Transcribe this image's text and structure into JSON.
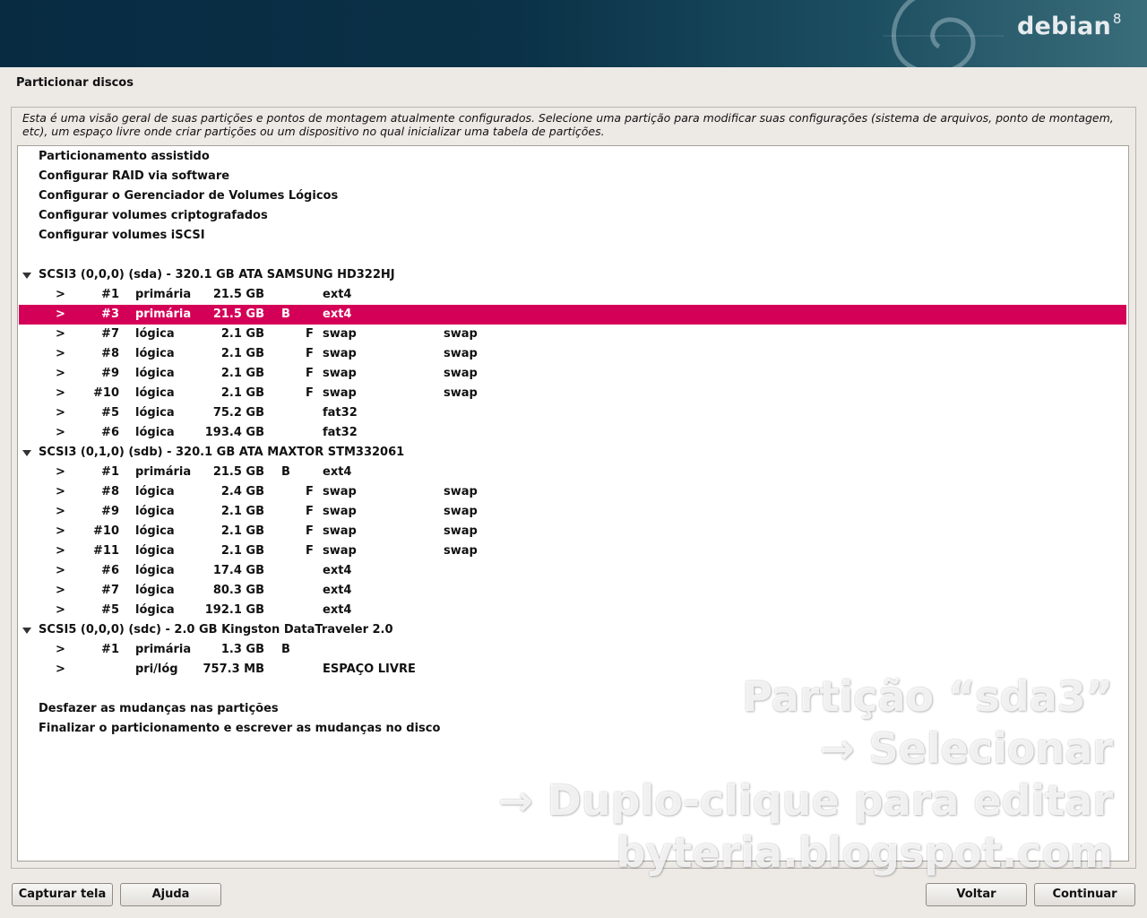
{
  "banner": {
    "logo_text": "debian",
    "logo_version": "8"
  },
  "page_title": "Particionar discos",
  "description": "Esta é uma visão geral de suas partições e pontos de montagem atualmente configurados. Selecione uma partição para modificar suas configurações (sistema de arquivos, ponto de montagem, etc), um espaço livre onde criar partições ou um dispositivo no qual inicializar uma tabela de partições.",
  "menu_top": [
    "Particionamento assistido",
    "Configurar RAID via software",
    "Configurar o Gerenciador de Volumes Lógicos",
    "Configurar volumes criptografados",
    "Configurar volumes iSCSI"
  ],
  "disks": [
    {
      "label": "SCSI3 (0,0,0) (sda) - 320.1 GB ATA SAMSUNG HD322HJ",
      "partitions": [
        {
          "arrow": ">",
          "num": "#1",
          "type": "primária",
          "size": "21.5 GB",
          "flag": "",
          "fs": "ext4",
          "mount": ""
        },
        {
          "arrow": ">",
          "num": "#3",
          "type": "primária",
          "size": "21.5 GB",
          "flag": "B",
          "fs": "ext4",
          "mount": "",
          "selected": true
        },
        {
          "arrow": ">",
          "num": "#7",
          "type": "lógica",
          "size": "2.1 GB",
          "flag": "F",
          "fs": "swap",
          "mount": "swap"
        },
        {
          "arrow": ">",
          "num": "#8",
          "type": "lógica",
          "size": "2.1 GB",
          "flag": "F",
          "fs": "swap",
          "mount": "swap"
        },
        {
          "arrow": ">",
          "num": "#9",
          "type": "lógica",
          "size": "2.1 GB",
          "flag": "F",
          "fs": "swap",
          "mount": "swap"
        },
        {
          "arrow": ">",
          "num": "#10",
          "type": "lógica",
          "size": "2.1 GB",
          "flag": "F",
          "fs": "swap",
          "mount": "swap"
        },
        {
          "arrow": ">",
          "num": "#5",
          "type": "lógica",
          "size": "75.2 GB",
          "flag": "",
          "fs": "fat32",
          "mount": ""
        },
        {
          "arrow": ">",
          "num": "#6",
          "type": "lógica",
          "size": "193.4 GB",
          "flag": "",
          "fs": "fat32",
          "mount": ""
        }
      ]
    },
    {
      "label": "SCSI3 (0,1,0) (sdb) - 320.1 GB ATA MAXTOR STM332061",
      "partitions": [
        {
          "arrow": ">",
          "num": "#1",
          "type": "primária",
          "size": "21.5 GB",
          "flag": "B",
          "fs": "ext4",
          "mount": ""
        },
        {
          "arrow": ">",
          "num": "#8",
          "type": "lógica",
          "size": "2.4 GB",
          "flag": "F",
          "fs": "swap",
          "mount": "swap"
        },
        {
          "arrow": ">",
          "num": "#9",
          "type": "lógica",
          "size": "2.1 GB",
          "flag": "F",
          "fs": "swap",
          "mount": "swap"
        },
        {
          "arrow": ">",
          "num": "#10",
          "type": "lógica",
          "size": "2.1 GB",
          "flag": "F",
          "fs": "swap",
          "mount": "swap"
        },
        {
          "arrow": ">",
          "num": "#11",
          "type": "lógica",
          "size": "2.1 GB",
          "flag": "F",
          "fs": "swap",
          "mount": "swap"
        },
        {
          "arrow": ">",
          "num": "#6",
          "type": "lógica",
          "size": "17.4 GB",
          "flag": "",
          "fs": "ext4",
          "mount": ""
        },
        {
          "arrow": ">",
          "num": "#7",
          "type": "lógica",
          "size": "80.3 GB",
          "flag": "",
          "fs": "ext4",
          "mount": ""
        },
        {
          "arrow": ">",
          "num": "#5",
          "type": "lógica",
          "size": "192.1 GB",
          "flag": "",
          "fs": "ext4",
          "mount": ""
        }
      ]
    },
    {
      "label": "SCSI5 (0,0,0) (sdc) - 2.0 GB Kingston DataTraveler 2.0",
      "partitions": [
        {
          "arrow": ">",
          "num": "#1",
          "type": "primária",
          "size": "1.3 GB",
          "flag": "B",
          "fs": "",
          "mount": ""
        },
        {
          "arrow": ">",
          "num": "",
          "type": "pri/lóg",
          "size": "757.3 MB",
          "flag": "",
          "fs": "ESPAÇO LIVRE",
          "mount": ""
        }
      ]
    }
  ],
  "menu_bottom": [
    "Desfazer as mudanças nas partições",
    "Finalizar o particionamento e escrever as mudanças no disco"
  ],
  "watermark": [
    "Partição “sda3”",
    "→ Selecionar",
    "→ Duplo-clique para editar",
    "byteria.blogspot.com"
  ],
  "buttons": {
    "screenshot": "Capturar tela",
    "help": "Ajuda",
    "back": "Voltar",
    "continue": "Continuar"
  },
  "colors": {
    "selection": "#d40057",
    "banner": "#0a3147"
  }
}
